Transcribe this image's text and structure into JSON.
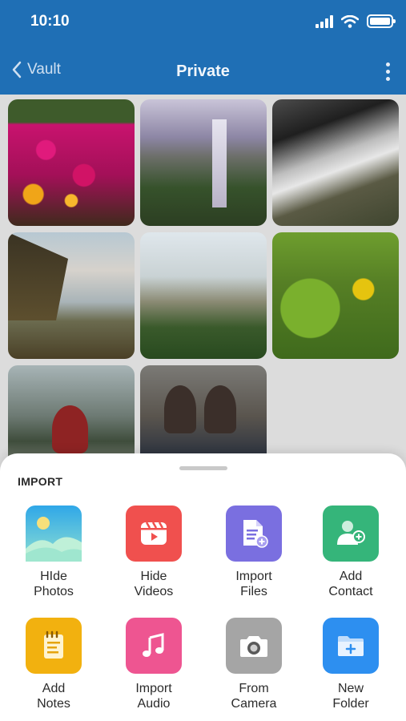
{
  "status_bar": {
    "time": "10:10"
  },
  "nav": {
    "back_label": "Vault",
    "title": "Private"
  },
  "import_sheet": {
    "section_title": "IMPORT",
    "actions": [
      {
        "label": "HIde\nPhotos",
        "icon": "photos-icon",
        "color": "#38b6e6"
      },
      {
        "label": "Hide\nVideos",
        "icon": "video-icon",
        "color": "#f0504e"
      },
      {
        "label": "Import\nFiles",
        "icon": "file-icon",
        "color": "#7a6fe0"
      },
      {
        "label": "Add\nContact",
        "icon": "add-contact-icon",
        "color": "#35b57a"
      },
      {
        "label": "Add\nNotes",
        "icon": "notes-icon",
        "color": "#f2b10f"
      },
      {
        "label": "Import\nAudio",
        "icon": "music-icon",
        "color": "#ee5591"
      },
      {
        "label": "From\nCamera",
        "icon": "camera-icon",
        "color": "#a5a5a5"
      },
      {
        "label": "New\nFolder",
        "icon": "folder-icon",
        "color": "#2d8ff0"
      }
    ]
  },
  "colors": {
    "header": "#1f6fb5",
    "sheet": "#ffffff"
  }
}
